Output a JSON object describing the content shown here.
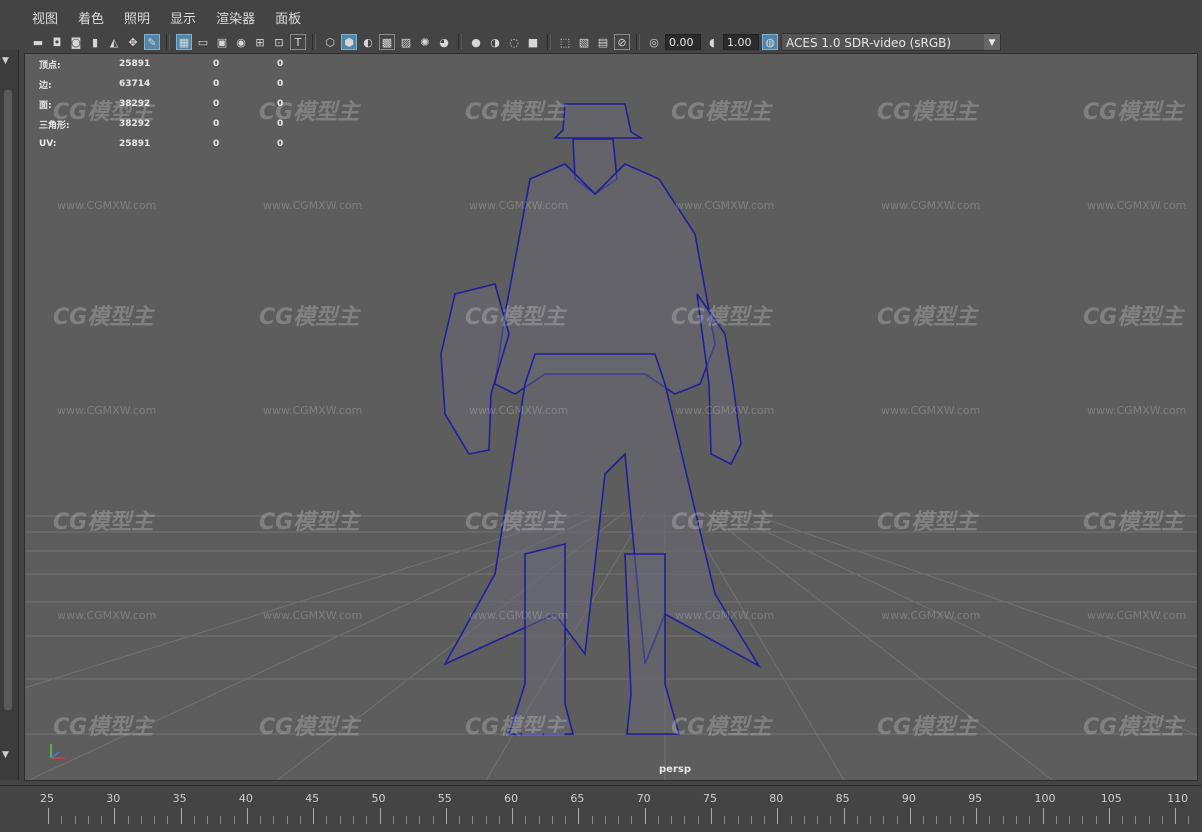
{
  "menubar": {
    "items": [
      "视图",
      "着色",
      "照明",
      "显示",
      "渲染器",
      "面板"
    ]
  },
  "toolbar": {
    "exposure_value": "0.00",
    "gamma_value": "1.00",
    "color_space": "ACES 1.0 SDR-video (sRGB)"
  },
  "hud": {
    "rows": [
      {
        "label": "顶点:",
        "v1": "25891",
        "v2": "0",
        "v3": "0"
      },
      {
        "label": "边:",
        "v1": "63714",
        "v2": "0",
        "v3": "0"
      },
      {
        "label": "面:",
        "v1": "38292",
        "v2": "0",
        "v3": "0"
      },
      {
        "label": "三角形:",
        "v1": "38292",
        "v2": "0",
        "v3": "0"
      },
      {
        "label": "UV:",
        "v1": "25891",
        "v2": "0",
        "v3": "0"
      }
    ]
  },
  "viewport": {
    "camera_label": "persp"
  },
  "timeline": {
    "ticks": [
      "25",
      "30",
      "35",
      "40",
      "45",
      "50",
      "55",
      "60",
      "65",
      "70",
      "75",
      "80",
      "85",
      "90",
      "95",
      "100",
      "105",
      "110"
    ]
  },
  "watermark": {
    "logo_text": "CG模型主",
    "url_text": "www.CGMXW.com"
  },
  "colors": {
    "wire": "#1f1f9a",
    "grid": "#6f6f6f",
    "accent": "#5285a6"
  }
}
